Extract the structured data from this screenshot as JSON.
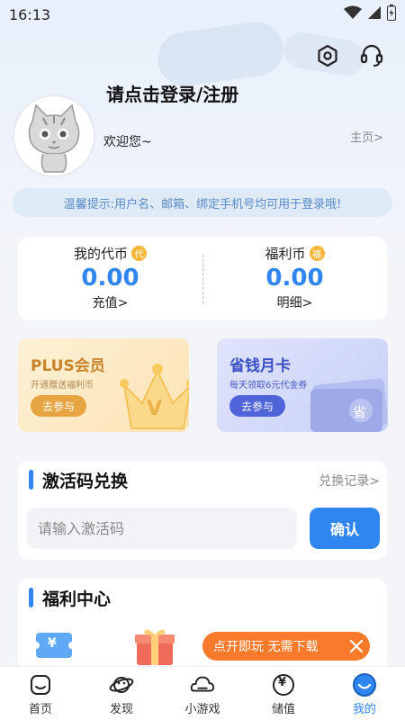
{
  "status_bar": {
    "time": "16:13"
  },
  "profile": {
    "login_prompt": "请点击登录/注册",
    "welcome": "欢迎您~",
    "homepage_link": "主页>"
  },
  "tip": "温馨提示:用户名、邮箱、绑定手机号均可用于登录哦!",
  "coins": {
    "daibi": {
      "label": "我的代币",
      "badge": "代",
      "value": "0.00",
      "action": "充值>"
    },
    "fulibi": {
      "label": "福利币",
      "badge": "福",
      "value": "0.00",
      "action": "明细>"
    }
  },
  "promos": {
    "plus": {
      "title": "PLUS会员",
      "subtitle": "开通赠送福利币",
      "button": "去参与",
      "mark": "V"
    },
    "month": {
      "title": "省钱月卡",
      "subtitle": "每天领取6元代金券",
      "button": "去参与",
      "mark": "省"
    }
  },
  "activation": {
    "title": "激活码兑换",
    "history_link": "兑换记录>",
    "placeholder": "请输入激活码",
    "confirm": "确认"
  },
  "welfare": {
    "title": "福利中心",
    "coupon_symbol": "¥"
  },
  "float_banner": {
    "text": "点开即玩 无需下载"
  },
  "nav": {
    "items": [
      {
        "label": "首页",
        "icon": "home-icon"
      },
      {
        "label": "发现",
        "icon": "planet-icon"
      },
      {
        "label": "小游戏",
        "icon": "cloud-icon"
      },
      {
        "label": "储值",
        "icon": "yen-icon"
      },
      {
        "label": "我的",
        "icon": "smile-icon"
      }
    ],
    "active_index": 4,
    "yen_symbol": "¥"
  },
  "colors": {
    "accent": "#2f86f0",
    "orange": "#f97a2b",
    "gold": "#f5b63a"
  }
}
